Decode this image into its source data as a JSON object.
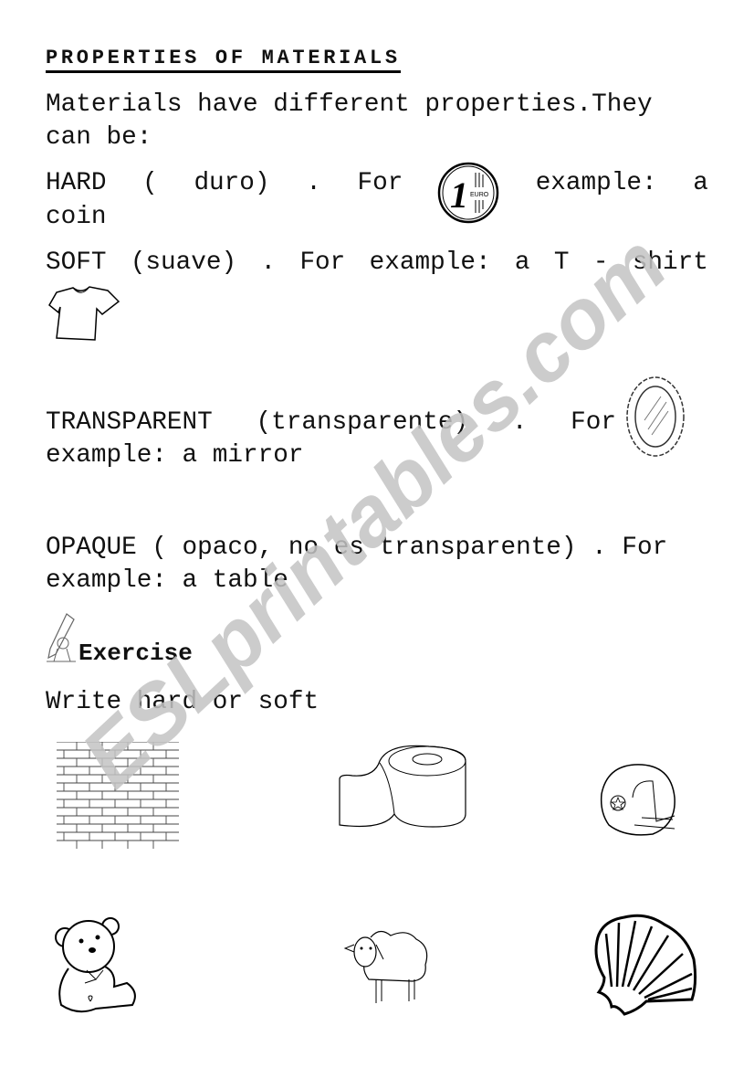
{
  "title": "PROPERTIES OF MATERIALS",
  "intro": [
    "Materials have different properties.They",
    "can be:"
  ],
  "hard": {
    "words": [
      "HARD",
      "(",
      "duro)",
      ".",
      "For",
      "example:",
      "a"
    ],
    "cont": "coin",
    "image": "euro-coin-icon"
  },
  "soft": {
    "words": [
      "SOFT",
      "(suave)",
      ".",
      "For",
      "example:",
      "a",
      "T",
      "-",
      "shirt"
    ],
    "image": "tshirt-icon"
  },
  "transparent": {
    "words": [
      "TRANSPARENT",
      "(transparente)",
      ".",
      "For"
    ],
    "cont": "example: a mirror",
    "image": "mirror-icon"
  },
  "opaque": {
    "line1": "OPAQUE ( opaco, no es transparente) . For",
    "line2": "example: a table"
  },
  "exercise": {
    "heading": "Exercise",
    "instruction": "Write hard or soft",
    "items": [
      "brick-wall",
      "toilet-paper-roll",
      "helmet",
      "teddy-bear",
      "sheep",
      "seashell"
    ]
  },
  "watermark": "ESLprintables.com"
}
